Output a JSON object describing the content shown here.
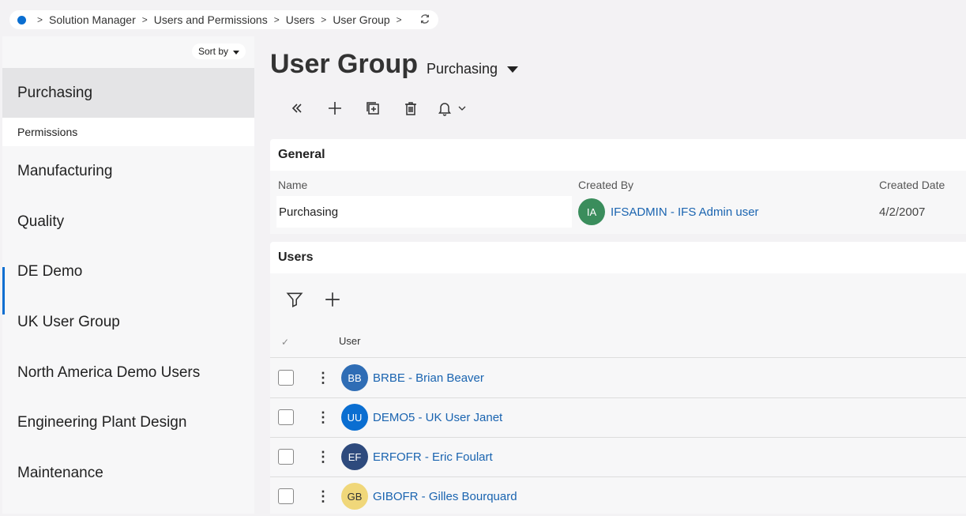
{
  "breadcrumb": {
    "items": [
      "Solution Manager",
      "Users and Permissions",
      "Users",
      "User Group"
    ],
    "separator": ">"
  },
  "nav": {
    "sort_label": "Sort by",
    "selected": "Purchasing",
    "sub_item": "Permissions",
    "items": [
      "Manufacturing",
      "Quality",
      "DE Demo",
      "UK User Group",
      "North America Demo Users",
      "Engineering Plant Design",
      "Maintenance"
    ]
  },
  "header": {
    "title": "User Group",
    "selector_value": "Purchasing"
  },
  "general": {
    "title": "General",
    "name_label": "Name",
    "name_value": "Purchasing",
    "created_by_label": "Created By",
    "created_by_initials": "IA",
    "created_by_value": "IFSADMIN - IFS Admin user",
    "created_date_label": "Created Date",
    "created_date_value": "4/2/2007"
  },
  "users": {
    "title": "Users",
    "column_user": "User",
    "check_glyph": "✓",
    "rows": [
      {
        "initials": "BB",
        "label": "BRBE - Brian Beaver",
        "color": "#2f6db5"
      },
      {
        "initials": "UU",
        "label": "DEMO5 - UK User Janet",
        "color": "#0a6ed1"
      },
      {
        "initials": "EF",
        "label": "ERFOFR - Eric Foulart",
        "color": "#2e4a7d"
      },
      {
        "initials": "GB",
        "label": "GIBOFR - Gilles Bourquard",
        "color": "#f0d77a"
      }
    ]
  },
  "colors": {
    "accent": "#0a6ed1",
    "link": "#1a64b0",
    "created_by_avatar": "#3a8d5c"
  }
}
